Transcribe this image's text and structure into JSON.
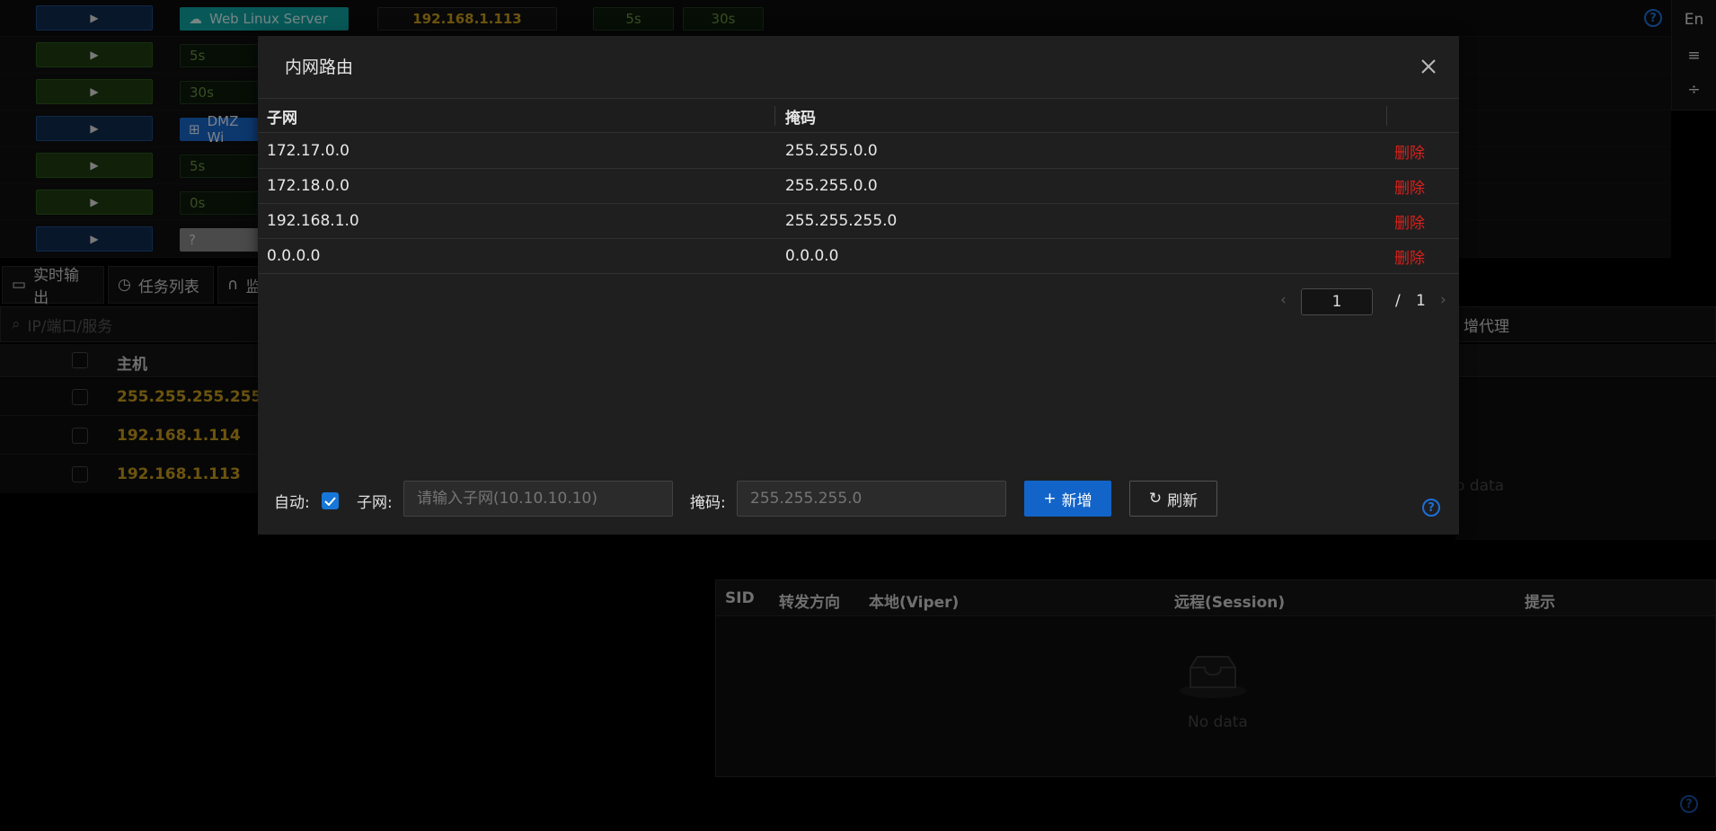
{
  "background": {
    "top_row": {
      "host": "Web Linux Server",
      "ip": "192.168.1.113",
      "t1": "5s",
      "t2": "30s"
    },
    "session_tags": [
      "5s",
      "30s",
      "DMZ Wi",
      "5s",
      "0s",
      "?"
    ],
    "lang_button": "En",
    "tabs": [
      "实时输出",
      "任务列表",
      "监"
    ],
    "search_placeholder": "IP/端口/服务",
    "host_table": {
      "header": "主机",
      "rows": [
        "255.255.255.255",
        "192.168.1.114",
        "192.168.1.113"
      ]
    },
    "proxy_tab_label": "增代理",
    "proxy_no_data_partial": "o data",
    "forward_table": {
      "columns": [
        "SID",
        "转发方向",
        "本地(Viper)",
        "远程(Session)",
        "提示"
      ],
      "empty_text": "No data"
    }
  },
  "modal": {
    "title": "内网路由",
    "columns": [
      "子网",
      "掩码"
    ],
    "rows": [
      {
        "subnet": "172.17.0.0",
        "mask": "255.255.0.0",
        "action": "删除"
      },
      {
        "subnet": "172.18.0.0",
        "mask": "255.255.0.0",
        "action": "删除"
      },
      {
        "subnet": "192.168.1.0",
        "mask": "255.255.255.0",
        "action": "删除"
      },
      {
        "subnet": "0.0.0.0",
        "mask": "0.0.0.0",
        "action": "删除"
      }
    ],
    "pagination": {
      "current": "1",
      "separator": "/",
      "total": "1"
    },
    "form": {
      "auto_label": "自动:",
      "auto_checked": true,
      "subnet_label": "子网:",
      "subnet_placeholder": "请输入子网(10.10.10.10)",
      "mask_label": "掩码:",
      "mask_placeholder": "255.255.255.0",
      "add_label": "新增",
      "refresh_label": "刷新"
    }
  },
  "colors": {
    "accent": "#1264c8",
    "danger": "#d9211c",
    "ip_gold": "#c59a1a"
  }
}
